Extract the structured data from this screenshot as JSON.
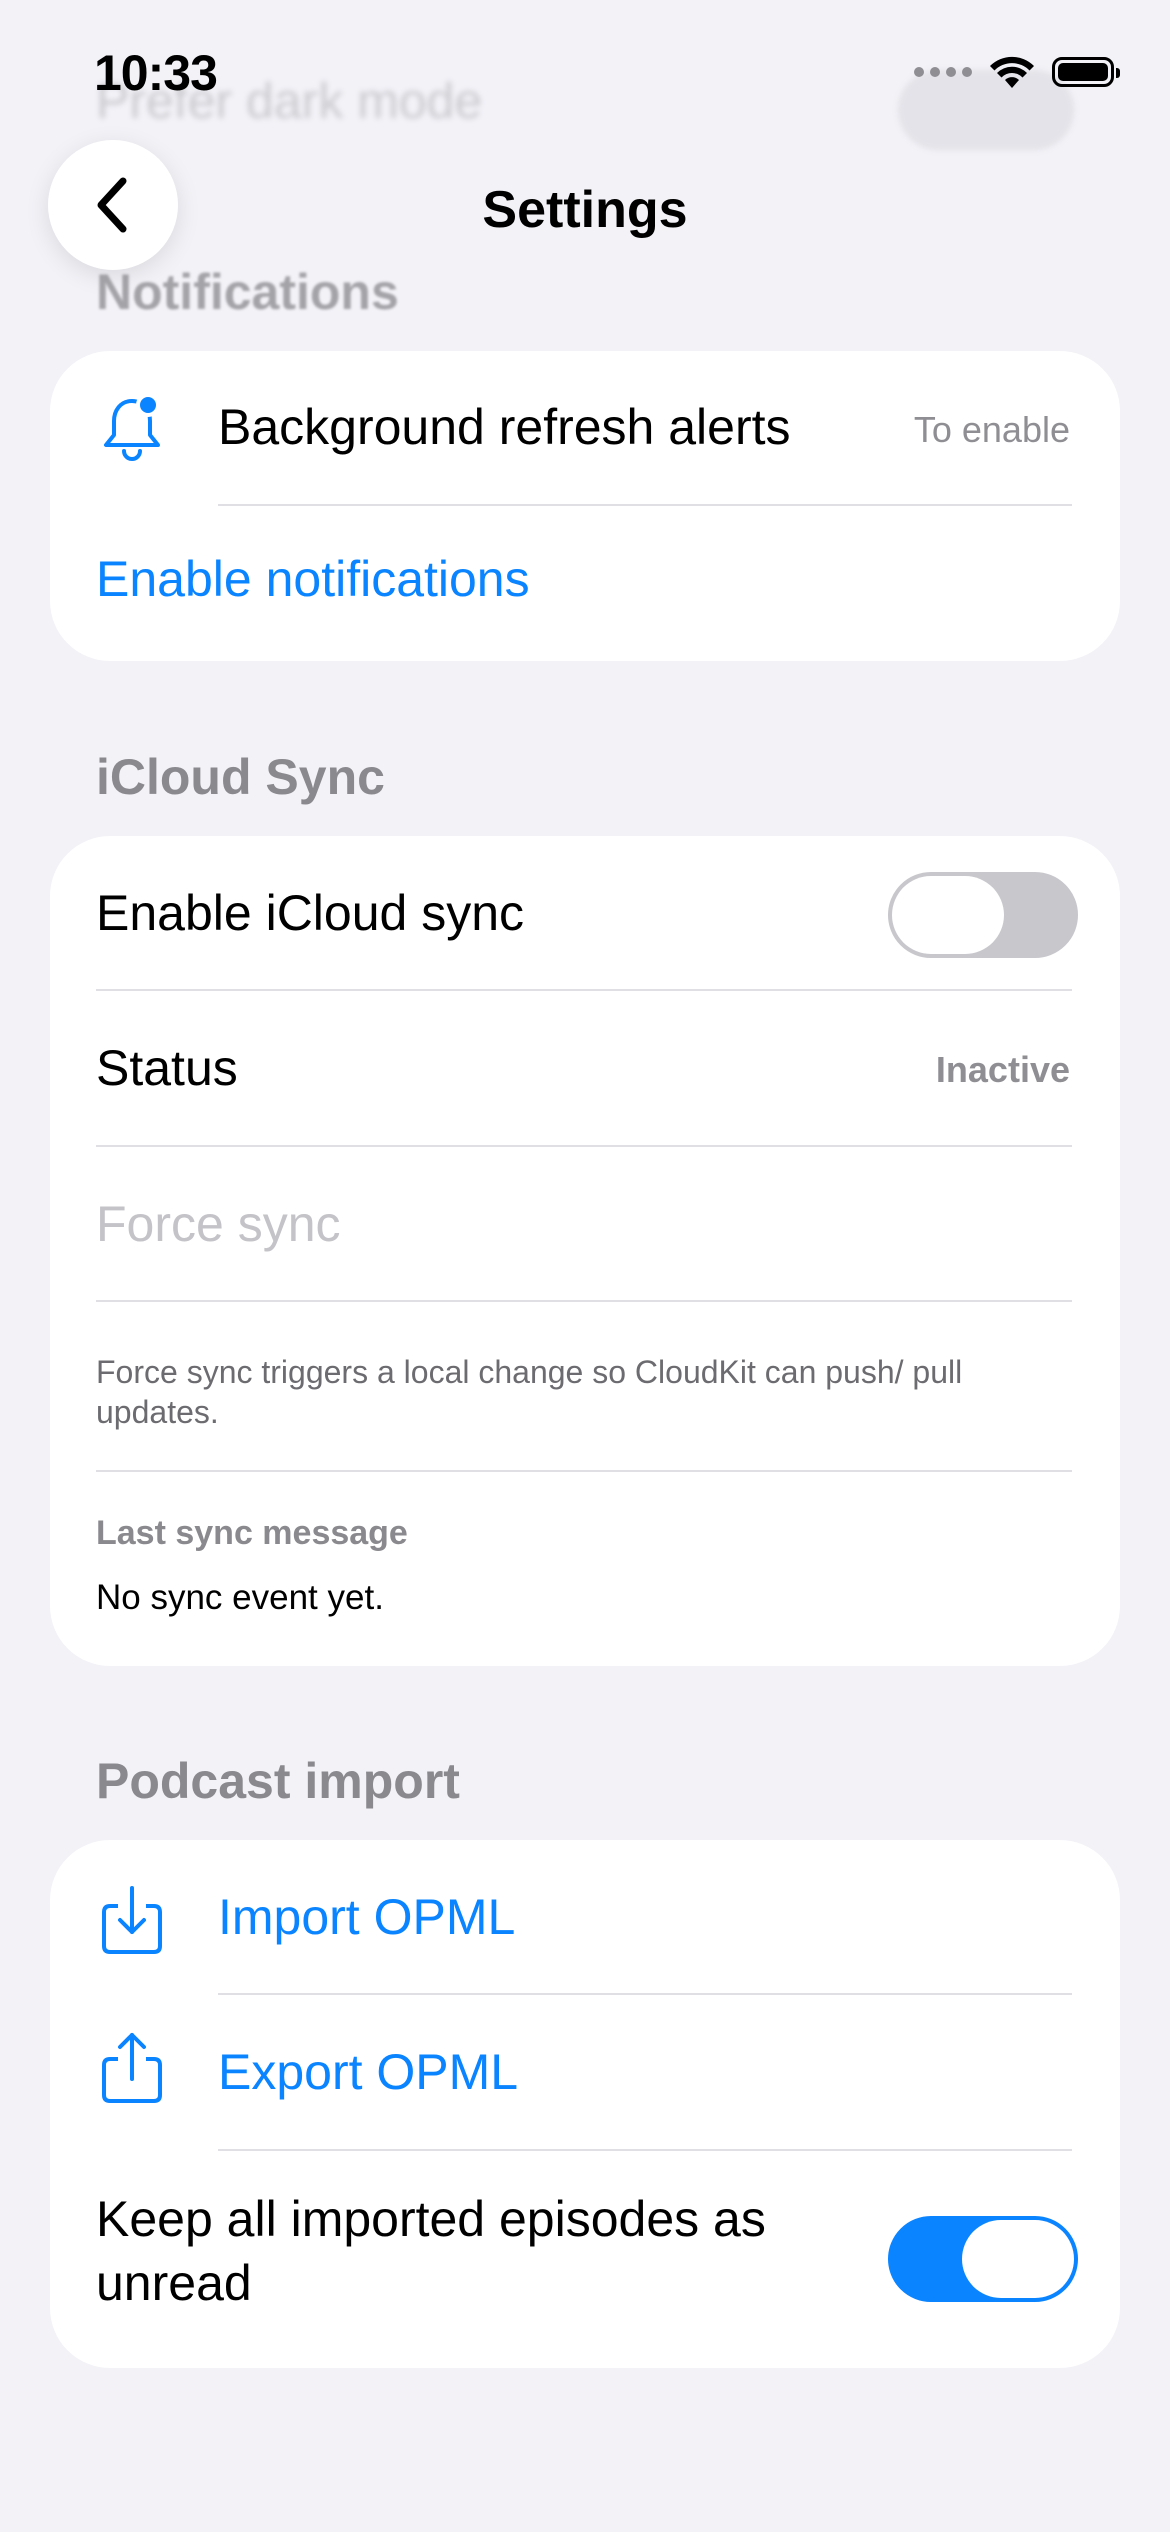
{
  "status_bar": {
    "time": "10:33"
  },
  "ghost": {
    "label": "Prefer dark mode"
  },
  "nav": {
    "title": "Settings"
  },
  "notifications": {
    "header": "Notifications",
    "alerts_label": "Background refresh alerts",
    "alerts_value": "To enable",
    "enable_label": "Enable notifications"
  },
  "icloud": {
    "header": "iCloud Sync",
    "enable_label": "Enable iCloud sync",
    "enable_on": false,
    "status_label": "Status",
    "status_value": "Inactive",
    "force_label": "Force sync",
    "footnote": "Force sync triggers a local change so CloudKit can push/ pull updates.",
    "last_heading": "Last sync message",
    "last_message": "No sync event yet."
  },
  "podcast": {
    "header": "Podcast import",
    "import_label": "Import OPML",
    "export_label": "Export OPML",
    "keep_label": "Keep all imported episodes as unread",
    "keep_on": true
  },
  "colors": {
    "accent": "#0a84ff",
    "background": "#f2f2f7",
    "secondary_text": "#8e8e93"
  },
  "icons": {
    "back": "chevron-left-icon",
    "alerts": "bell-badge-icon",
    "import": "tray-arrow-down-icon",
    "export": "square-arrow-up-icon",
    "wifi": "wifi-icon",
    "battery": "battery-icon",
    "signal": "cellular-signal-icon"
  }
}
